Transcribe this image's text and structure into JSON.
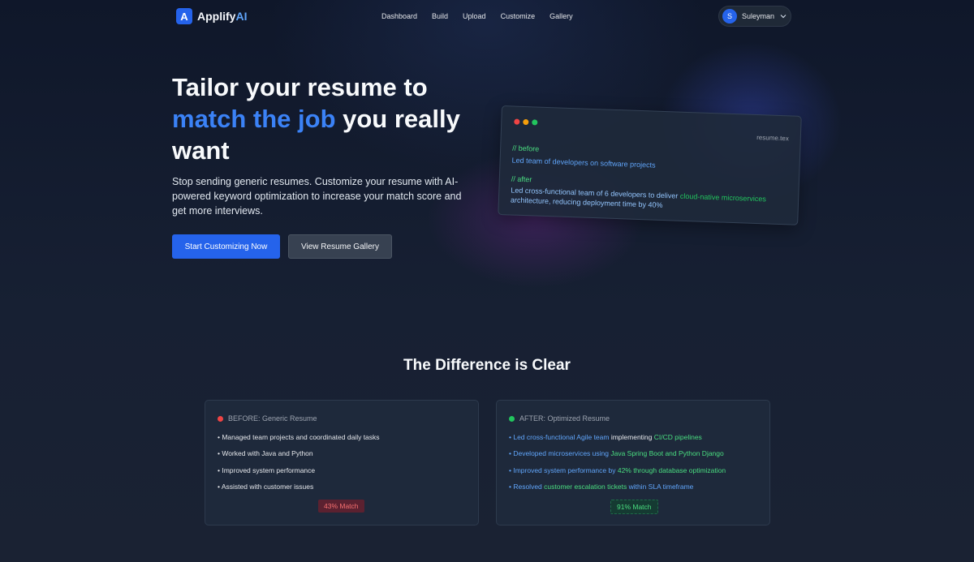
{
  "brand": {
    "name_main": "Applify",
    "name_accent": "AI",
    "mark": "A"
  },
  "nav": {
    "links": [
      "Dashboard",
      "Build",
      "Upload",
      "Customize",
      "Gallery"
    ],
    "user": {
      "initial": "S",
      "name": "Suleyman",
      "menu_icon": "chevron-down-icon"
    }
  },
  "hero": {
    "title_part1": "Tailor your resume to",
    "title_highlight": "match the job",
    "title_part2": " you really want",
    "subtitle": "Stop sending generic resumes. Customize your resume with AI-powered keyword optimization to increase your match score and get more interviews.",
    "primary_cta": "Start Customizing Now",
    "secondary_cta": "View Resume Gallery"
  },
  "code_card": {
    "filename": "resume.tex",
    "before_comment": "// before",
    "before_line": "Led team of developers on software projects",
    "after_comment": "// after",
    "after_line_part1": "Led cross-functional team of 6 developers to deliver ",
    "after_line_highlight": "cloud-native microservices",
    "after_line_part2": "architecture, reducing deployment time by 40%"
  },
  "comparison": {
    "title": "The Difference is Clear",
    "before": {
      "label": "BEFORE: Generic Resume",
      "items": [
        "• Managed team projects and coordinated daily tasks",
        "• Worked with Java and Python",
        "• Improved system performance",
        "• Assisted with customer issues"
      ],
      "match": "43% Match"
    },
    "after": {
      "label": "AFTER: Optimized Resume",
      "items": [
        [
          "• ",
          "Led cross-functional Agile team",
          " implementing ",
          "CI/CD pipelines"
        ],
        [
          "• ",
          "Developed microservices using ",
          "Java Spring Boot and Python Django",
          ""
        ],
        [
          "• ",
          "Improved system performance by ",
          "42%",
          " through database optimization"
        ],
        [
          "• ",
          "Resolved ",
          "customer escalation tickets",
          " within SLA timeframe"
        ]
      ],
      "match": "91% Match"
    }
  },
  "colors": {
    "accent": "#2563eb",
    "highlight_blue": "#3b82f6",
    "highlight_green": "#4ade80",
    "bad": "#ef4444",
    "good": "#22c55e",
    "window_red": "#ef4444",
    "window_yellow": "#f59e0b",
    "window_green": "#22c55e"
  }
}
